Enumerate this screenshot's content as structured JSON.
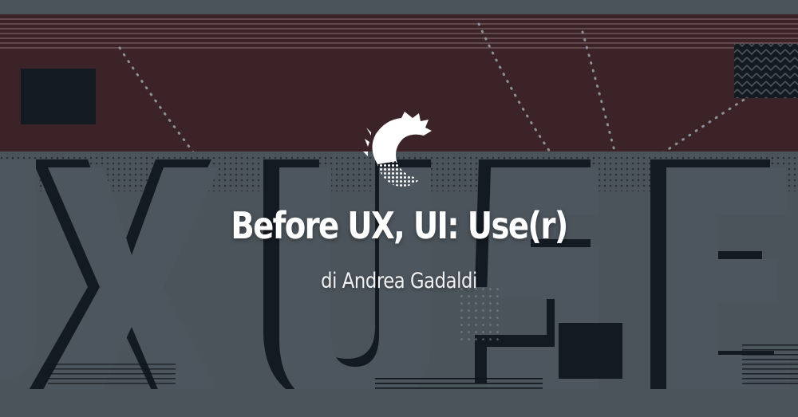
{
  "hero": {
    "title": "Before UX, UI: Use(r)",
    "byline": "di Andrea Gadaldi"
  },
  "background": {
    "lettering": "UXUSER"
  },
  "icons": {
    "logo": "dragon-crest-logo"
  },
  "colors": {
    "slate": "#4b535b",
    "maroon": "#3b2328",
    "navy": "#141a22",
    "text": "#ffffff"
  }
}
